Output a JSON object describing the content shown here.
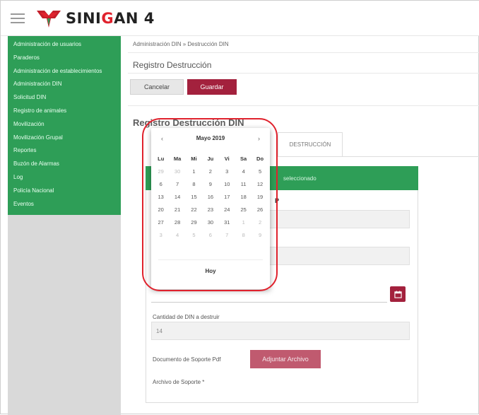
{
  "app": {
    "title_main": "SINI",
    "title_accent": "G",
    "title_end": "AN",
    "version": "4",
    "brand_red": "#e0222d",
    "brand_green": "#2e9e57",
    "accent": "#a3213d"
  },
  "sidebar": {
    "items": [
      "Administración de usuarios",
      "Paraderos",
      "Administración de establecimientos",
      "Administración DIN",
      "Solicitud DIN",
      "Registro de animales",
      "Movilización",
      "Movilización Grupal",
      "Reportes",
      "Buzón de Alarmas",
      "Log",
      "Policía Nacional",
      "Eventos"
    ]
  },
  "breadcrumb": "Administración DIN » Destrucción DIN",
  "page_title": "Registro Destrucción",
  "buttons": {
    "cancel": "Cancelar",
    "save": "Guardar",
    "attach": "Adjuntar Archivo"
  },
  "section_title": "Registro Destrucción DIN",
  "tab_label": "DESTRUCCIÓN",
  "card_header": "seleccionado",
  "stray_p": "P",
  "form": {
    "qty_label": "Cantidad de DIN a destruir",
    "qty_value": "14",
    "doc_label": "Documento de Soporte Pdf",
    "file_label": "Archivo de Soporte *"
  },
  "datepicker": {
    "prev": "‹",
    "next": "›",
    "month": "Mayo 2019",
    "weekdays": [
      "Lu",
      "Ma",
      "Mi",
      "Ju",
      "Vi",
      "Sa",
      "Do"
    ],
    "weeks": [
      [
        "29",
        "30",
        "1",
        "2",
        "3",
        "4",
        "5"
      ],
      [
        "6",
        "7",
        "8",
        "9",
        "10",
        "11",
        "12"
      ],
      [
        "13",
        "14",
        "15",
        "16",
        "17",
        "18",
        "19"
      ],
      [
        "20",
        "21",
        "22",
        "23",
        "24",
        "25",
        "26"
      ],
      [
        "27",
        "28",
        "29",
        "30",
        "31",
        "1",
        "2"
      ],
      [
        "3",
        "4",
        "5",
        "6",
        "7",
        "8",
        "9"
      ]
    ],
    "muted": [
      [
        0,
        0
      ],
      [
        0,
        1
      ],
      [
        4,
        5
      ],
      [
        4,
        6
      ],
      [
        5,
        0
      ],
      [
        5,
        1
      ],
      [
        5,
        2
      ],
      [
        5,
        3
      ],
      [
        5,
        4
      ],
      [
        5,
        5
      ],
      [
        5,
        6
      ]
    ],
    "today": "Hoy"
  },
  "icons": {
    "menu": "hamburger-icon",
    "logo": "sinigan-logo",
    "calendar": "calendar-icon"
  }
}
